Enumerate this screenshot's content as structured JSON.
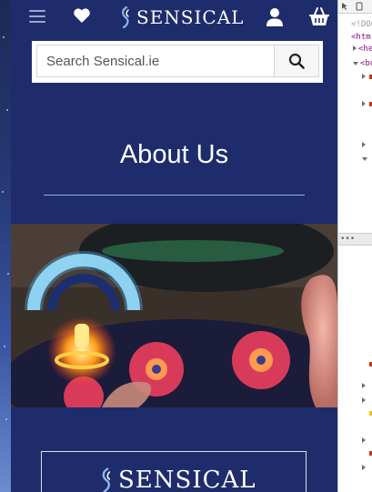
{
  "header": {
    "brand": "SENSICAL",
    "menu_icon": "hamburger-menu-icon",
    "wishlist_icon": "heart-icon",
    "account_icon": "user-icon",
    "cart_icon": "basket-icon"
  },
  "search": {
    "placeholder": "Search Sensical.ie",
    "button_icon": "search-icon"
  },
  "main": {
    "title": "About Us"
  },
  "footer": {
    "brand": "SENSICAL"
  },
  "devtools": {
    "doctype": "<!DOC",
    "html": "<htm",
    "head": "<he",
    "body": "<bo"
  },
  "colors": {
    "page_bg": "#1e2c6b",
    "accent_rule": "#8fb2e6",
    "text": "#ffffff"
  }
}
